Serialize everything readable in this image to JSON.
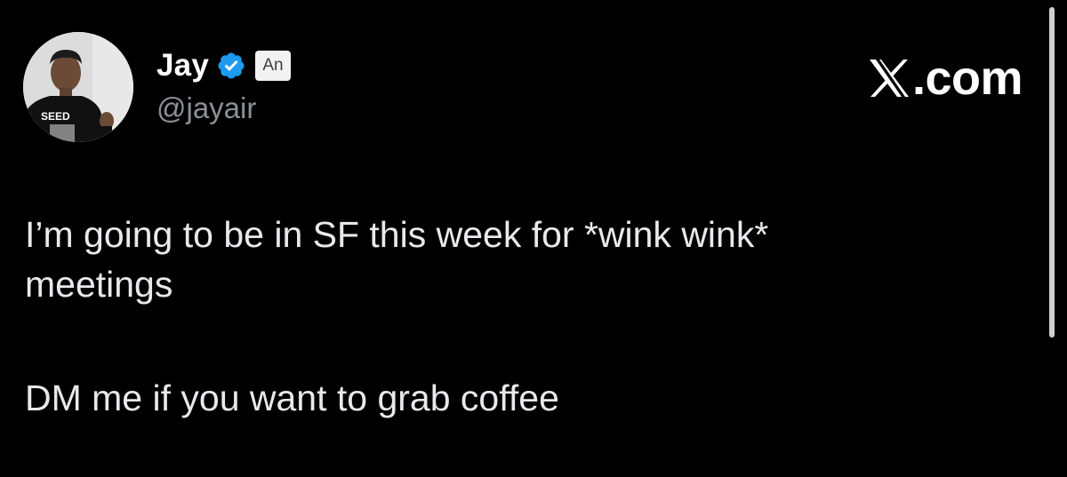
{
  "tweet": {
    "author": {
      "display_name": "Jay",
      "handle": "@jayair",
      "verified": true,
      "verified_color": "#1d9bf0",
      "translate_badge": "An",
      "avatar_shirt_text": "SEED"
    },
    "brand": {
      "text": ".com",
      "icon": "x-logo-icon"
    },
    "body": {
      "line1": "I’m going to be in SF this week for *wink wink*",
      "line2": "meetings",
      "line3": "DM me if you want to grab coffee"
    }
  },
  "colors": {
    "background": "#000000",
    "text": "#e7e9ea",
    "handle": "#8b9096"
  }
}
